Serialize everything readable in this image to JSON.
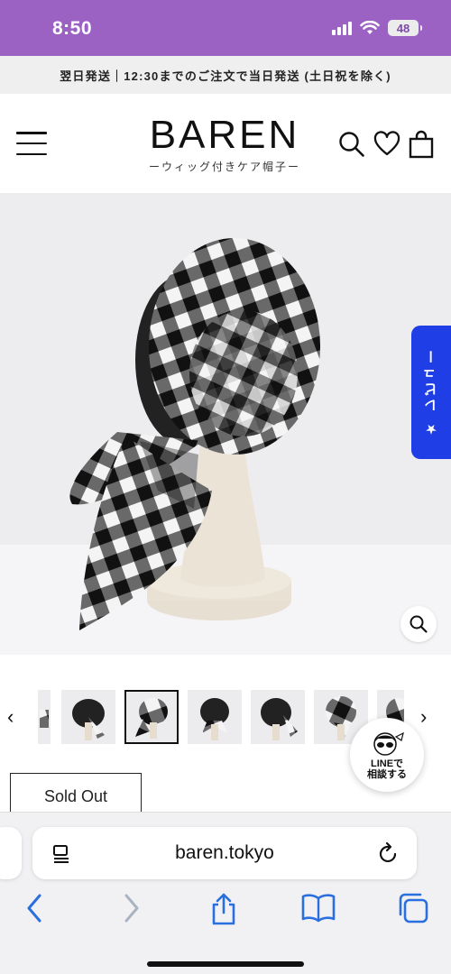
{
  "status_bar": {
    "time": "8:50",
    "battery": "48"
  },
  "announcement": {
    "text": "翌日発送｜12:30までのご注文で当日発送 (土日祝を除く)"
  },
  "header": {
    "logo": "BAREN",
    "tagline": "ーウィッグ付きケア帽子ー"
  },
  "icons": {
    "menu": "hamburger-icon",
    "search": "search-icon",
    "wishlist": "heart-icon",
    "cart": "shopping-bag-icon",
    "zoom": "zoom-icon",
    "prev": "chevron-left-icon",
    "next": "chevron-right-icon"
  },
  "review_tab": {
    "label": "★ レビュー"
  },
  "thumbnails": {
    "count": 8,
    "selected_index": 2,
    "prev_symbol": "‹",
    "next_symbol": "›"
  },
  "line_bubble": {
    "brand": "LINE",
    "suffix": "で",
    "label": "相談する"
  },
  "product": {
    "status": "Sold Out"
  },
  "colors": {
    "status_bar": "#9b62c4",
    "review_tab": "#1f3ee6",
    "accent_dark": "#111111"
  },
  "browser": {
    "url": "baren.tokyo"
  }
}
